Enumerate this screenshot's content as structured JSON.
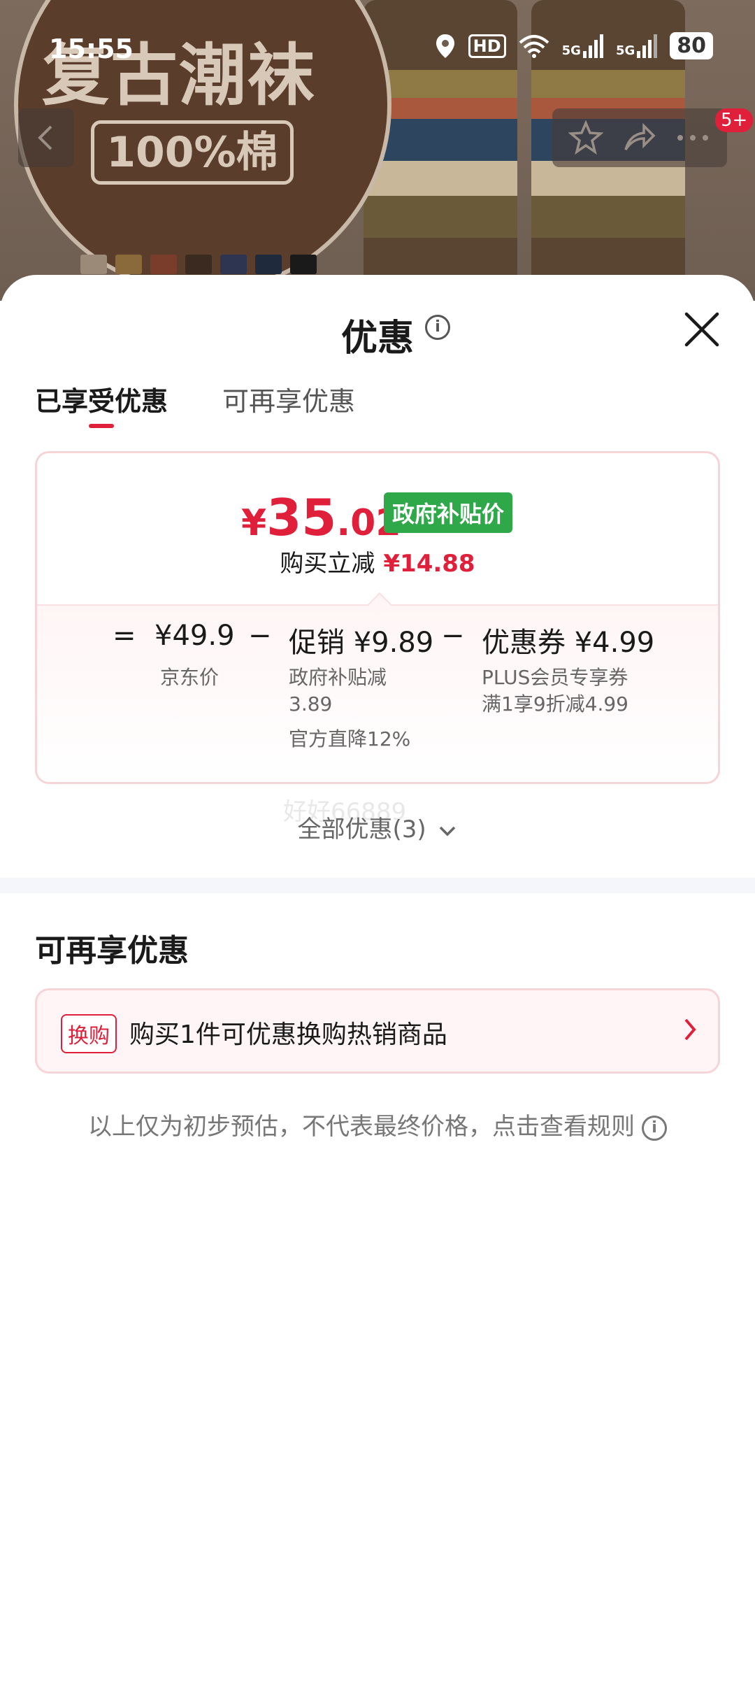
{
  "status_bar": {
    "time": "15:55",
    "network_hd": "HD",
    "sig1": "5G",
    "sig2": "5G",
    "battery": "80"
  },
  "background": {
    "banner_title": "复古潮袜",
    "banner_sub": "100%棉",
    "nav_badge": "5+"
  },
  "sheet": {
    "title": "优惠",
    "tabs": [
      {
        "label": "已享受优惠"
      },
      {
        "label": "可再享优惠"
      }
    ],
    "price": {
      "currency": "¥",
      "integer": "35",
      "decimal": ".02",
      "badge": "政府补贴价",
      "discount_label": "购买立减",
      "discount_amount": "¥14.88"
    },
    "formula": {
      "eq": "=",
      "minus": "−",
      "base_value": "¥49.9",
      "base_label": "京东价",
      "promo_value": "促销 ¥9.89",
      "promo_line1": "政府补贴减",
      "promo_line2": "3.89",
      "promo_line3": "官方直降12%",
      "coupon_value": "优惠券 ¥4.99",
      "coupon_line1": "PLUS会员专享券",
      "coupon_line2": "满1享9折减4.99"
    },
    "watermark": "好好66889",
    "all_discounts": "全部优惠(3)",
    "more_section": {
      "title": "可再享优惠",
      "badge": "换购",
      "text": "购买1件可优惠换购热销商品"
    },
    "footnote": "以上仅为初步预估，不代表最终价格，点击查看规则"
  }
}
